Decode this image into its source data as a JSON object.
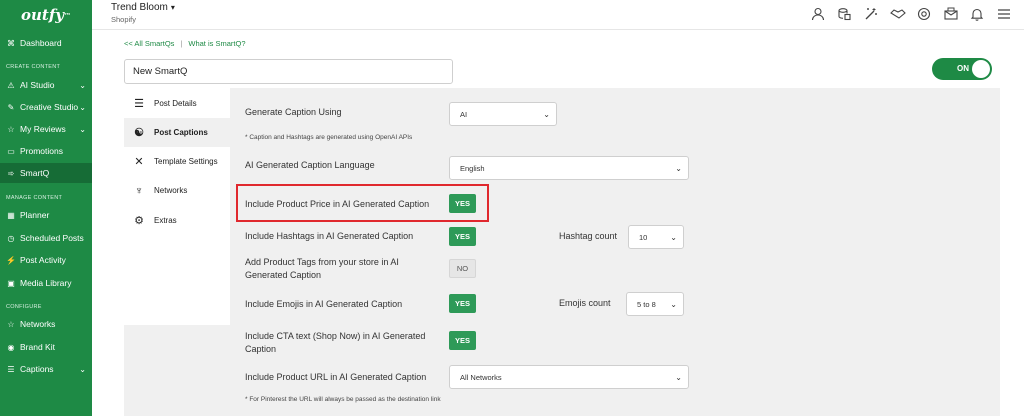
{
  "brand": {
    "logo_text": "outfy",
    "logo_mark": "™"
  },
  "header": {
    "store_name": "Trend Bloom",
    "store_caret": "▾",
    "platform": "Shopify",
    "icons": [
      "user-icon",
      "billing-icon",
      "magic-wand-icon",
      "handshake-icon",
      "support-icon",
      "mail-icon",
      "notification-bell-icon",
      "menu-icon"
    ]
  },
  "sidebar": {
    "sections": {
      "create": "CREATE CONTENT",
      "manage": "MANAGE CONTENT",
      "configure": "CONFIGURE"
    },
    "items": [
      {
        "label": "Dashboard",
        "icon": "dashboard-icon",
        "glyph": "⌘",
        "chevron": false
      },
      {
        "label": "AI Studio",
        "icon": "ai-studio-icon",
        "glyph": "⚠",
        "chevron": true
      },
      {
        "label": "Creative Studio",
        "icon": "creative-studio-icon",
        "glyph": "✎",
        "chevron": true
      },
      {
        "label": "My Reviews",
        "icon": "reviews-icon",
        "glyph": "☆",
        "chevron": true
      },
      {
        "label": "Promotions",
        "icon": "promotions-icon",
        "glyph": "▭",
        "chevron": false
      },
      {
        "label": "SmartQ",
        "icon": "smartq-icon",
        "glyph": "➾",
        "chevron": false,
        "active": true
      },
      {
        "label": "Planner",
        "icon": "planner-icon",
        "glyph": "▦",
        "chevron": false
      },
      {
        "label": "Scheduled Posts",
        "icon": "scheduled-posts-icon",
        "glyph": "◷",
        "chevron": false
      },
      {
        "label": "Post Activity",
        "icon": "post-activity-icon",
        "glyph": "⚡",
        "chevron": false
      },
      {
        "label": "Media Library",
        "icon": "media-library-icon",
        "glyph": "▣",
        "chevron": false
      },
      {
        "label": "Networks",
        "icon": "networks-icon",
        "glyph": "☆",
        "chevron": false
      },
      {
        "label": "Brand Kit",
        "icon": "brand-kit-icon",
        "glyph": "◉",
        "chevron": false
      },
      {
        "label": "Captions",
        "icon": "captions-icon",
        "glyph": "☰",
        "chevron": true
      }
    ],
    "chevron_glyph": "⌄"
  },
  "breadcrumb": {
    "back": "<< All SmartQs",
    "separator": "|",
    "help": "What is SmartQ?"
  },
  "smartq": {
    "name_value": "New SmartQ",
    "toggle_label": "ON",
    "toggle_on": true
  },
  "tabs": [
    {
      "label": "Post Details",
      "icon": "sliders-icon",
      "glyph": "☰",
      "active": false
    },
    {
      "label": "Post Captions",
      "icon": "caption-bubble-icon",
      "glyph": "☯",
      "active": true
    },
    {
      "label": "Template Settings",
      "icon": "tools-icon",
      "glyph": "✕",
      "active": false
    },
    {
      "label": "Networks",
      "icon": "network-link-icon",
      "glyph": "♆",
      "active": false
    },
    {
      "label": "Extras",
      "icon": "gear-icon",
      "glyph": "⚙",
      "active": false
    }
  ],
  "form": {
    "caption_using_label": "Generate Caption Using",
    "caption_using_value": "AI",
    "caption_note": "* Caption and Hashtags are generated using OpenAI APIs",
    "language_label": "AI Generated Caption Language",
    "language_value": "English",
    "price_label": "Include Product Price in AI Generated Caption",
    "price_value": "YES",
    "hashtags_label": "Include Hashtags in AI Generated Caption",
    "hashtags_value": "YES",
    "hashtag_count_label": "Hashtag count",
    "hashtag_count_value": "10",
    "tags_label_line1": "Add Product Tags from your store in AI",
    "tags_label_line2": "Generated Caption",
    "tags_value": "NO",
    "emojis_label": "Include Emojis in AI Generated Caption",
    "emojis_value": "YES",
    "emojis_count_label": "Emojis count",
    "emojis_count_value": "5 to 8",
    "cta_label_line1": "Include CTA text (Shop Now) in AI Generated",
    "cta_label_line2": "Caption",
    "cta_value": "YES",
    "url_label": "Include Product URL in AI Generated Caption",
    "url_value": "All Networks",
    "url_note": "* For Pinterest the URL will always be passed as the destination link",
    "select_arrow": "⌄"
  },
  "colors": {
    "brand_green": "#1e8a45",
    "active_green": "#166c36",
    "yes_green": "#2e9a58",
    "highlight_red": "#e0282e",
    "panel_bg": "#f0f0f0"
  }
}
